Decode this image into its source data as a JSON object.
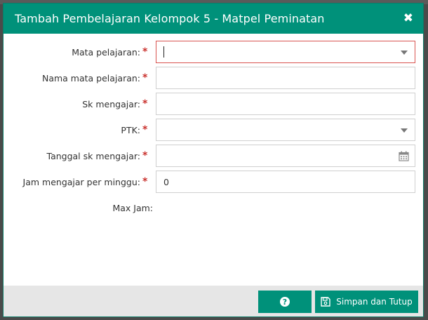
{
  "modal": {
    "title": "Tambah Pembelajaran Kelompok 5 - Matpel Peminatan",
    "close_icon": "✖"
  },
  "form": {
    "fields": [
      {
        "label": "Mata pelajaran:",
        "required": true,
        "type": "select",
        "value": ""
      },
      {
        "label": "Nama mata pelajaran:",
        "required": true,
        "type": "text",
        "value": ""
      },
      {
        "label": "Sk mengajar:",
        "required": true,
        "type": "text",
        "value": ""
      },
      {
        "label": "PTK:",
        "required": true,
        "type": "select",
        "value": ""
      },
      {
        "label": "Tanggal sk mengajar:",
        "required": true,
        "type": "date",
        "value": ""
      },
      {
        "label": "Jam mengajar per minggu:",
        "required": true,
        "type": "text",
        "value": "0"
      }
    ],
    "max_jam_label": "Max Jam:",
    "required_mark": "*"
  },
  "footer": {
    "help_icon": "?",
    "save_label": "Simpan dan Tutup",
    "save_icon": "save-icon"
  },
  "colors": {
    "primary": "#00917a",
    "required": "#c9302c",
    "focus_border": "#d9534f"
  }
}
